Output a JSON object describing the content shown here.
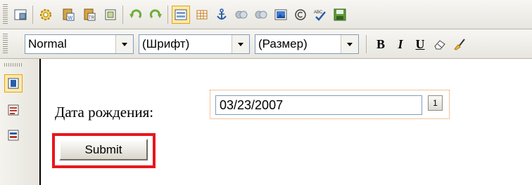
{
  "toolbar_top": {
    "buttons": [
      {
        "name": "fullscreen-icon"
      },
      {
        "name": "settings-gear-icon"
      },
      {
        "name": "paste-from-word-icon"
      },
      {
        "name": "paste-as-text-icon"
      },
      {
        "name": "paste-special-icon"
      },
      {
        "name": "undo-icon"
      },
      {
        "name": "redo-icon"
      },
      {
        "name": "insert-form-icon",
        "active": true
      },
      {
        "name": "insert-table-icon"
      },
      {
        "name": "anchor-icon"
      },
      {
        "name": "insert-link-icon"
      },
      {
        "name": "remove-link-icon"
      },
      {
        "name": "insert-image-icon"
      },
      {
        "name": "copyright-symbol-icon"
      },
      {
        "name": "spellcheck-icon"
      },
      {
        "name": "save-icon"
      }
    ]
  },
  "toolbar_format": {
    "style_select": "Normal",
    "font_select": "(Шрифт)",
    "size_select": "(Размер)",
    "bold_label": "B",
    "italic_label": "I",
    "underline_label": "U"
  },
  "sidebar": {
    "buttons": [
      {
        "name": "design-view-icon",
        "active": true
      },
      {
        "name": "html-view-icon"
      },
      {
        "name": "preview-view-icon"
      }
    ]
  },
  "form": {
    "date_label": "Дата рождения:",
    "date_value": "03/23/2007",
    "calendar_button_label": "1",
    "submit_label": "Submit"
  },
  "colors": {
    "highlight_red": "#e8161b",
    "active_orange": "#e1a21f",
    "active_fill": "#ffe9a8"
  }
}
